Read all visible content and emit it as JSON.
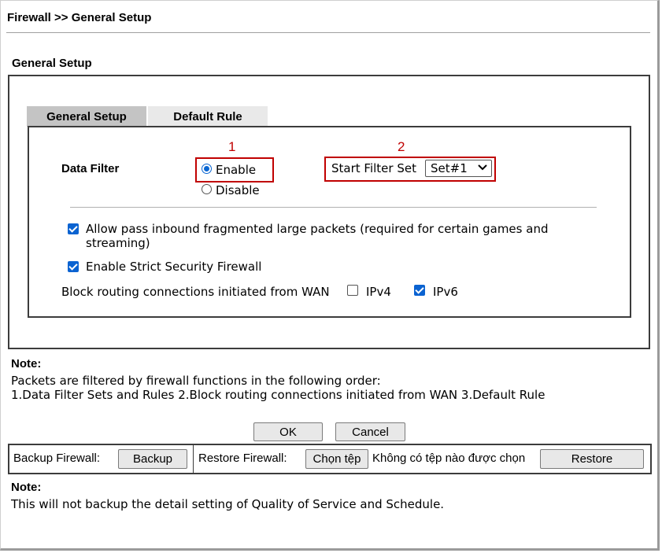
{
  "header": {
    "title": "Firewall >> General Setup"
  },
  "section": {
    "title": "General Setup"
  },
  "tabs": [
    {
      "label": "General Setup"
    },
    {
      "label": "Default Rule"
    }
  ],
  "data_filter": {
    "label": "Data Filter",
    "options": [
      {
        "label": "Enable",
        "checked": true
      },
      {
        "label": "Disable",
        "checked": false
      }
    ],
    "annotation": "1"
  },
  "start_filter_set": {
    "label": "Start Filter Set",
    "value": "Set#1",
    "annotation": "2"
  },
  "options": {
    "allow_pass_line1": "Allow pass inbound fragmented large packets (required for certain games and",
    "allow_pass_line2": "streaming)",
    "allow_pass_checked": true,
    "strict_security": "Enable Strict Security Firewall",
    "strict_security_checked": true,
    "block_routing": "Block routing connections initiated from WAN",
    "ipv4": {
      "label": "IPv4",
      "checked": false
    },
    "ipv6": {
      "label": "IPv6",
      "checked": true
    }
  },
  "note1": {
    "title": "Note:",
    "line1": "Packets are filtered by firewall functions in the following order:",
    "line2": "1.Data Filter Sets and Rules  2.Block routing connections initiated from WAN  3.Default Rule"
  },
  "buttons": {
    "ok": "OK",
    "cancel": "Cancel"
  },
  "backup": {
    "label": "Backup Firewall:",
    "button": "Backup",
    "restore_label": "Restore Firewall:",
    "choose_file": "Chọn tệp",
    "no_file": "Không có tệp nào được chọn",
    "restore_button": "Restore"
  },
  "note2": {
    "title": "Note:",
    "text": "This will not backup the detail setting of Quality of Service and Schedule."
  },
  "colors": {
    "accent": "#0b63d1",
    "annotation": "#c00000"
  }
}
